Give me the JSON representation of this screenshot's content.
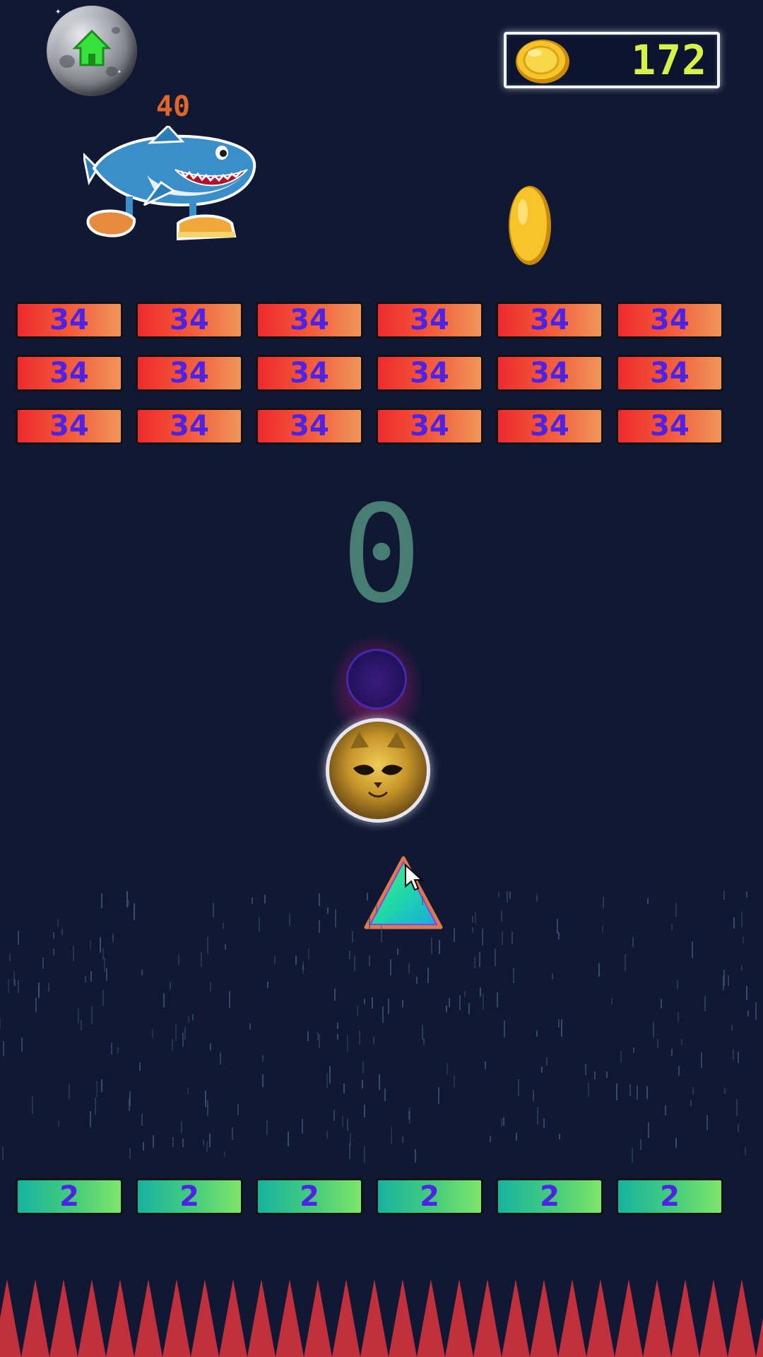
{
  "hud": {
    "coins": "172"
  },
  "enemy": {
    "hp": "40"
  },
  "combo_counter": "0",
  "brick_rows_top": [
    [
      "34",
      "34",
      "34",
      "34",
      "34",
      "34"
    ],
    [
      "34",
      "34",
      "34",
      "34",
      "34",
      "34"
    ],
    [
      "34",
      "34",
      "34",
      "34",
      "34",
      "34"
    ]
  ],
  "brick_row_bottom": [
    "2",
    "2",
    "2",
    "2",
    "2",
    "2"
  ],
  "colors": {
    "background": "#101833",
    "brick_text": "#4f23e6",
    "coin_value": "#d6f24a",
    "enemy_hp": "#e0662a",
    "spikes": "#c1303c"
  },
  "icons": [
    "home-icon",
    "coin-icon",
    "shark-character",
    "gold-coin",
    "ball",
    "triangle-shooter",
    "mouse-cursor-icon",
    "spikes"
  ]
}
